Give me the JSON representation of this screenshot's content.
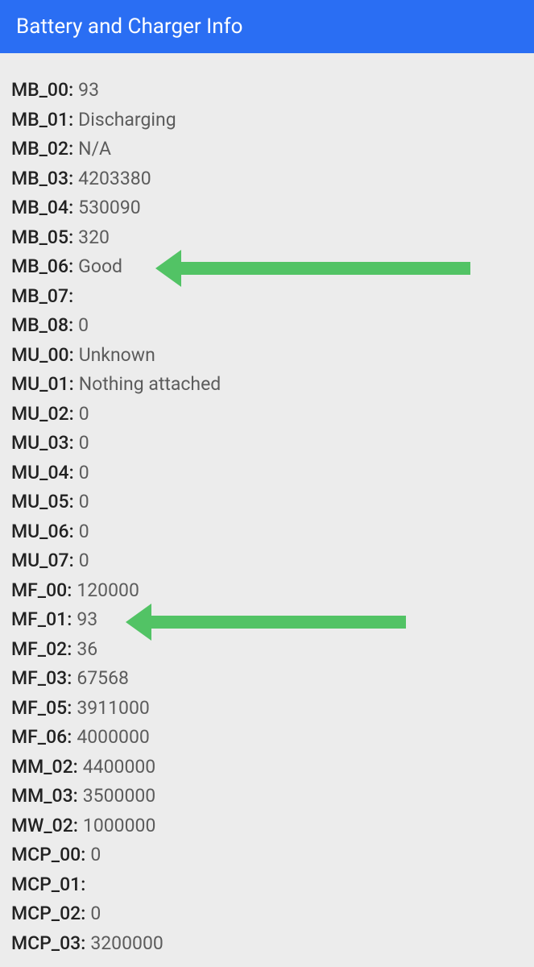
{
  "header": {
    "title": "Battery and Charger Info"
  },
  "rows": [
    {
      "key": "MB_00",
      "value": "93"
    },
    {
      "key": "MB_01",
      "value": "Discharging"
    },
    {
      "key": "MB_02",
      "value": "N/A"
    },
    {
      "key": "MB_03",
      "value": "4203380"
    },
    {
      "key": "MB_04",
      "value": "530090"
    },
    {
      "key": "MB_05",
      "value": "320"
    },
    {
      "key": "MB_06",
      "value": "Good"
    },
    {
      "key": "MB_07",
      "value": ""
    },
    {
      "key": "MB_08",
      "value": "0"
    },
    {
      "key": "MU_00",
      "value": "Unknown"
    },
    {
      "key": "MU_01",
      "value": "Nothing attached"
    },
    {
      "key": "MU_02",
      "value": "0"
    },
    {
      "key": "MU_03",
      "value": "0"
    },
    {
      "key": "MU_04",
      "value": "0"
    },
    {
      "key": "MU_05",
      "value": "0"
    },
    {
      "key": "MU_06",
      "value": "0"
    },
    {
      "key": "MU_07",
      "value": "0"
    },
    {
      "key": "MF_00",
      "value": "120000"
    },
    {
      "key": "MF_01",
      "value": "93"
    },
    {
      "key": "MF_02",
      "value": "36"
    },
    {
      "key": "MF_03",
      "value": "67568"
    },
    {
      "key": "MF_05",
      "value": "3911000"
    },
    {
      "key": "MF_06",
      "value": "4000000"
    },
    {
      "key": "MM_02",
      "value": "4400000"
    },
    {
      "key": "MM_03",
      "value": "3500000"
    },
    {
      "key": "MW_02",
      "value": "1000000"
    },
    {
      "key": "MCP_00",
      "value": "0"
    },
    {
      "key": "MCP_01",
      "value": ""
    },
    {
      "key": "MCP_02",
      "value": "0"
    },
    {
      "key": "MCP_03",
      "value": "3200000"
    }
  ]
}
